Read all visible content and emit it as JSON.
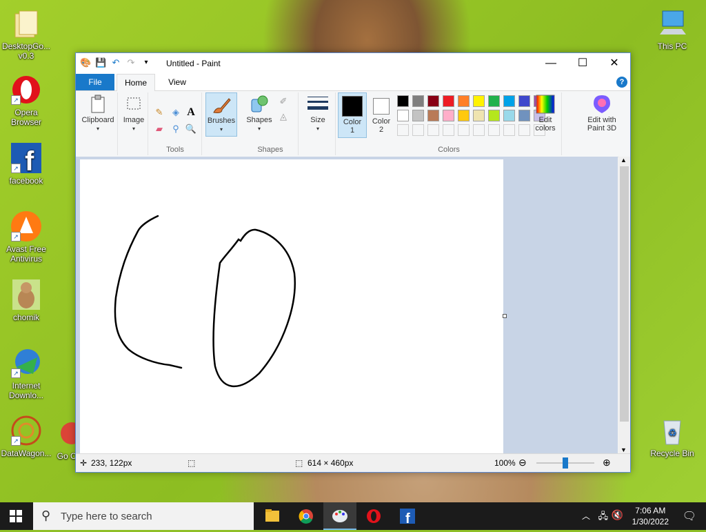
{
  "desktop": {
    "icons": [
      {
        "label": "DesktopGo... v0.3"
      },
      {
        "label": "Opera Browser"
      },
      {
        "label": "facebook"
      },
      {
        "label": "Avast Free Antivirus"
      },
      {
        "label": "chomik"
      },
      {
        "label": "Internet Downlo..."
      },
      {
        "label": "DataWagon..."
      },
      {
        "label": "Go Ch"
      },
      {
        "label": "This PC"
      },
      {
        "label": "Recycle Bin"
      }
    ]
  },
  "window": {
    "title": "Untitled - Paint",
    "tabs": {
      "file": "File",
      "home": "Home",
      "view": "View"
    },
    "help": "?",
    "ribbon": {
      "clipboard": "Clipboard",
      "image": "Image",
      "tools": "Tools",
      "brushes": "Brushes",
      "shapes_btn": "Shapes",
      "shapes_group": "Shapes",
      "size": "Size",
      "color1": "Color 1",
      "color2": "Color 2",
      "edit_colors": "Edit colors",
      "colors_group": "Colors",
      "edit_paint3d": "Edit with Paint 3D",
      "text_tool": "A"
    },
    "palette_row1": [
      "#000000",
      "#7f7f7f",
      "#880015",
      "#ed1c24",
      "#ff7f27",
      "#fff200",
      "#22b14c",
      "#00a2e8",
      "#3f48cc",
      "#a349a4"
    ],
    "palette_row2": [
      "#ffffff",
      "#c3c3c3",
      "#b97a57",
      "#ffaec9",
      "#ffc90e",
      "#efe4b0",
      "#b5e61d",
      "#99d9ea",
      "#7092be",
      "#c8bfe7"
    ],
    "status": {
      "cursor_pos": "233, 122px",
      "canvas_size": "614 × 460px",
      "zoom": "100%"
    }
  },
  "taskbar": {
    "search_placeholder": "Type here to search",
    "time": "7:06 AM",
    "date": "1/30/2022"
  }
}
